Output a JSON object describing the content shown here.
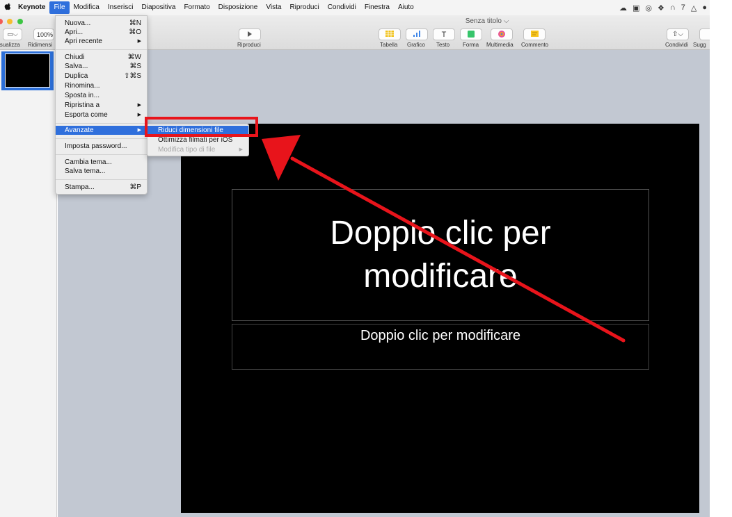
{
  "menubar": {
    "app": "Keynote",
    "items": [
      "File",
      "Modifica",
      "Inserisci",
      "Diapositiva",
      "Formato",
      "Disposizione",
      "Vista",
      "Riproduci",
      "Condividi",
      "Finestra",
      "Aiuto"
    ],
    "status_text": "7"
  },
  "window": {
    "title": "Senza titolo ⌵",
    "zoom": "100%"
  },
  "toolbar": {
    "visualizza": "isualizza",
    "ridimensiona": "Ridimensi",
    "riproduci": "Riproduci",
    "tabella": "Tabella",
    "grafico": "Grafico",
    "testo": "Testo",
    "forma": "Forma",
    "multimedia": "Multimedia",
    "commento": "Commento",
    "condividi": "Condividi",
    "suggerimenti": "Sugg"
  },
  "file_menu": {
    "nuova": "Nuova...",
    "nuova_sc": "⌘N",
    "apri": "Apri...",
    "apri_sc": "⌘O",
    "apri_recente": "Apri recente",
    "chiudi": "Chiudi",
    "chiudi_sc": "⌘W",
    "salva": "Salva...",
    "salva_sc": "⌘S",
    "duplica": "Duplica",
    "duplica_sc": "⇧⌘S",
    "rinomina": "Rinomina...",
    "sposta": "Sposta in...",
    "ripristina": "Ripristina a",
    "esporta": "Esporta come",
    "avanzate": "Avanzate",
    "password": "Imposta password...",
    "cambia_tema": "Cambia tema...",
    "salva_tema": "Salva tema...",
    "stampa": "Stampa...",
    "stampa_sc": "⌘P",
    "arrow": "▶"
  },
  "submenu": {
    "riduci": "Riduci dimensioni file",
    "ottimizza": "Ottimizza filmati per iOS",
    "modifica_tipo": "Modifica tipo di file",
    "arrow": "▶"
  },
  "slide": {
    "title": "Doppio clic per modificare",
    "subtitle": "Doppio clic per modificare"
  },
  "colors": {
    "menu_highlight": "#2f6fdc",
    "annotation": "#e8141b"
  }
}
